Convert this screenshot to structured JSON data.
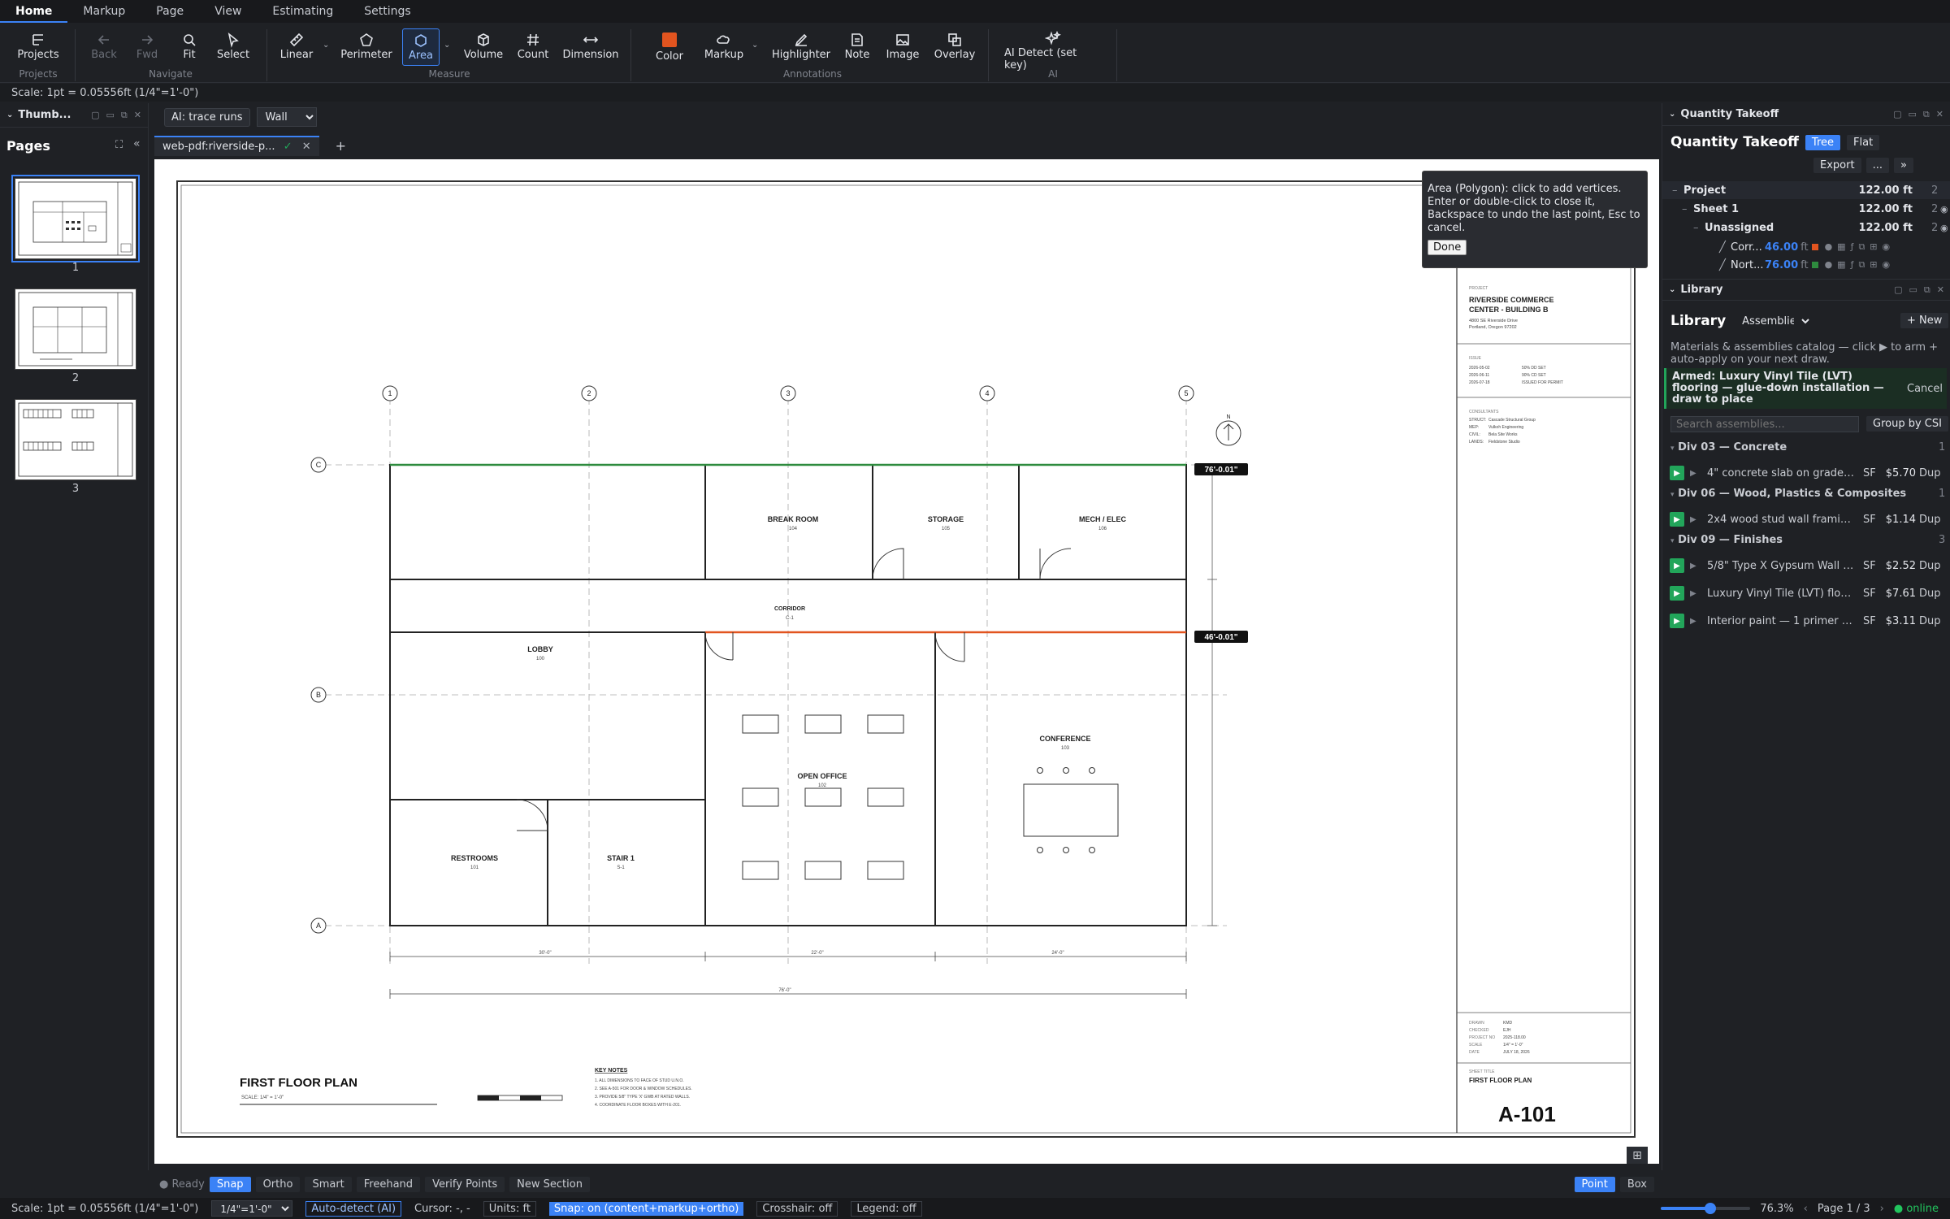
{
  "menu": {
    "items": [
      "Home",
      "Markup",
      "Page",
      "View",
      "Estimating",
      "Settings"
    ],
    "active": "Home"
  },
  "ribbon": {
    "buttons": {
      "projects": "Projects",
      "back": "Back",
      "fwd": "Fwd",
      "fit": "Fit",
      "select": "Select",
      "linear": "Linear",
      "perimeter": "Perimeter",
      "area": "Area",
      "volume": "Volume",
      "count": "Count",
      "dimension": "Dimension",
      "color": "Color",
      "markup": "Markup",
      "highlighter": "Highlighter",
      "note": "Note",
      "image": "Image",
      "overlay": "Overlay",
      "ai_detect": "AI Detect (set key)"
    },
    "groups": {
      "projects": "Projects",
      "navigate": "Navigate",
      "measure": "Measure",
      "annotations": "Annotations",
      "ai": "AI"
    },
    "accent_color": "#e2541f"
  },
  "scale_text": "Scale: 1pt = 0.05556ft (1/4\"=1'-0\")",
  "left_panel": {
    "header": "Thumb...",
    "pages_title": "Pages",
    "pages": [
      "1",
      "2",
      "3"
    ],
    "selected": "1"
  },
  "docbar": {
    "ai_trace": "AI: trace runs",
    "layer_select": "Wall"
  },
  "tabs": {
    "doc_tab": "web-pdf:riverside-p...",
    "add": "+"
  },
  "tooltip": {
    "text": "Area (Polygon): click to add vertices. Enter or double-click to close it, Backspace to undo the last point, Esc to cancel.",
    "done": "Done"
  },
  "plan": {
    "grid_cols": [
      "1",
      "2",
      "3",
      "4",
      "5"
    ],
    "grid_rows": [
      "C",
      "B",
      "A"
    ],
    "north": "N",
    "rooms": {
      "break_room": "BREAK ROOM",
      "break_no": "104",
      "storage": "STORAGE",
      "storage_no": "105",
      "mech": "MECH / ELEC",
      "mech_no": "106",
      "corridor": "CORRIDOR",
      "corridor_no": "C-1",
      "lobby": "LOBBY",
      "lobby_no": "100",
      "open_office": "OPEN OFFICE",
      "open_no": "102",
      "conference": "CONFERENCE",
      "conf_no": "103",
      "restrooms": "RESTROOMS",
      "rest_no": "101",
      "stair": "STAIR 1",
      "stair_no": "S-1"
    },
    "measure_tags": [
      "76'-0.01\"",
      "46'-0.01\""
    ],
    "dims": [
      "30'-0\"",
      "22'-0\"",
      "24'-0\"",
      "76'-0\""
    ],
    "title": "FIRST FLOOR PLAN",
    "scale": "SCALE: 1/4\" = 1'-0\"",
    "key_notes_title": "KEY NOTES",
    "key_notes": [
      "1. ALL DIMENSIONS TO FACE OF STUD U.N.O.",
      "2. SEE A-501 FOR DOOR & WINDOW SCHEDULES.",
      "3. PROVIDE 5/8\" TYPE 'X' GWB AT RATED WALLS.",
      "4. COORDINATE FLOOR BOXES WITH E-201."
    ],
    "titleblock": {
      "project_label": "PROJECT",
      "project_name_1": "RIVERSIDE COMMERCE",
      "project_name_2": "CENTER - BUILDING B",
      "address_1": "4800 SE Riverside Drive",
      "address_2": "Portland, Oregon 97202",
      "issue_label": "ISSUE",
      "issues": [
        [
          "2026-05-02",
          "50% DD SET"
        ],
        [
          "2026-06-11",
          "90% CD SET"
        ],
        [
          "2026-07-18",
          "ISSUED FOR PERMIT"
        ]
      ],
      "consultants_label": "CONSULTANTS",
      "consultants": [
        [
          "STRUCT:",
          "Cascade Structural Group"
        ],
        [
          "MEP:",
          "Vulkoh Engineering"
        ],
        [
          "CIVIL:",
          "Bela Site Works"
        ],
        [
          "LANDS:",
          "Fieldstone Studio"
        ]
      ],
      "meta": [
        [
          "DRAWN",
          "KMD"
        ],
        [
          "CHECKED",
          "EJH"
        ],
        [
          "PROJECT NO",
          "2025-118.00"
        ],
        [
          "SCALE",
          "1/4\" = 1'-0\""
        ],
        [
          "DATE",
          "JULY 18, 2026"
        ]
      ],
      "sheet_title_label": "SHEET TITLE",
      "sheet_title": "FIRST FLOOR PLAN",
      "sheet_number": "A-101"
    }
  },
  "bottom_tools": {
    "ready": "Ready",
    "snap": "Snap",
    "ortho": "Ortho",
    "smart": "Smart",
    "freehand": "Freehand",
    "verify": "Verify Points",
    "new_section": "New Section",
    "point": "Point",
    "box": "Box"
  },
  "status": {
    "scale": "Scale: 1pt = 0.05556ft (1/4\"=1'-0\")",
    "scale_select": "1/4\"=1'-0\"",
    "auto_detect": "Auto-detect (AI)",
    "cursor": "Cursor: -, -",
    "units": "Units: ft",
    "snap": "Snap: on (content+markup+ortho)",
    "crosshair": "Crosshair: off",
    "legend": "Legend: off",
    "zoom": "76.3%",
    "zoom_level": 0.55,
    "page": "Page 1 / 3",
    "online": "online"
  },
  "quantity_takeoff": {
    "panel_header": "Quantity Takeoff",
    "title": "Quantity Takeoff",
    "tree": "Tree",
    "flat": "Flat",
    "export": "Export",
    "more": "...",
    "expand": "»",
    "rows": [
      {
        "name": "Project",
        "value": "122.00 ft",
        "count": "2"
      },
      {
        "name": "Sheet 1",
        "value": "122.00 ft",
        "count": "2"
      },
      {
        "name": "Unassigned",
        "value": "122.00 ft",
        "count": "2"
      }
    ],
    "items": [
      {
        "name": "Corr...",
        "value": "46.00",
        "unit": "ft",
        "color": "#e2541f"
      },
      {
        "name": "Nort...",
        "value": "76.00",
        "unit": "ft",
        "color": "#2e8b3e"
      }
    ]
  },
  "library": {
    "panel_header": "Library",
    "title": "Library",
    "mode": "Assemblies",
    "new": "+ New",
    "hint": "Materials & assemblies catalog — click ▶ to arm + auto-apply on your next draw.",
    "armed": "Armed: Luxury Vinyl Tile (LVT) flooring — glue-down installation — draw to place",
    "cancel": "Cancel",
    "search_placeholder": "Search assemblies...",
    "group_csi": "Group by CSI",
    "categories": [
      {
        "name": "Div 03 — Concrete",
        "count": "1",
        "items": [
          {
            "name": "4\" concrete slab on grade ...",
            "unit": "SF",
            "price": "$5.70",
            "dup": "Dup"
          }
        ]
      },
      {
        "name": "Div 06 — Wood, Plastics & Composites",
        "count": "1",
        "items": [
          {
            "name": "2x4 wood stud wall framing...",
            "unit": "SF",
            "price": "$1.14",
            "dup": "Dup"
          }
        ]
      },
      {
        "name": "Div 09 — Finishes",
        "count": "3",
        "items": [
          {
            "name": "5/8\" Type X Gypsum Wall B...",
            "unit": "SF",
            "price": "$2.52",
            "dup": "Dup"
          },
          {
            "name": "Luxury Vinyl Tile (LVT) floor...",
            "unit": "SF",
            "price": "$7.61",
            "dup": "Dup"
          },
          {
            "name": "Interior paint — 1 primer co...",
            "unit": "SF",
            "price": "$3.11",
            "dup": "Dup"
          }
        ]
      }
    ]
  }
}
